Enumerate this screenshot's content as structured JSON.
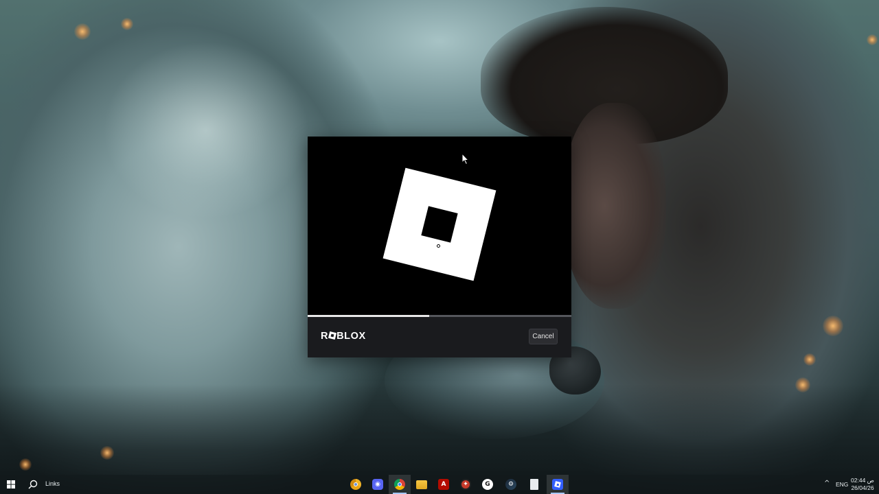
{
  "launcher": {
    "brand": "RBLOX",
    "cancel_label": "Cancel",
    "progress": 0.46,
    "colors": {
      "background": "#000000",
      "footer": "#1a1b1e",
      "progress_fill": "#e8e8e8",
      "progress_track": "#55575c"
    }
  },
  "taskbar": {
    "search_label": "Links",
    "apps": [
      {
        "name": "chrome-canary-icon",
        "active": false
      },
      {
        "name": "discord-icon",
        "active": false
      },
      {
        "name": "chrome-icon",
        "active": true
      },
      {
        "name": "file-explorer-icon",
        "active": false
      },
      {
        "name": "acrobat-icon",
        "active": false
      },
      {
        "name": "game-app-icon",
        "active": false
      },
      {
        "name": "github-icon",
        "active": false
      },
      {
        "name": "steam-icon",
        "active": false
      },
      {
        "name": "document-icon",
        "active": false
      },
      {
        "name": "roblox-icon",
        "active": true
      }
    ],
    "tray": {
      "language": "ENG",
      "time": "02:44 ص",
      "date": "26/04/26"
    }
  }
}
